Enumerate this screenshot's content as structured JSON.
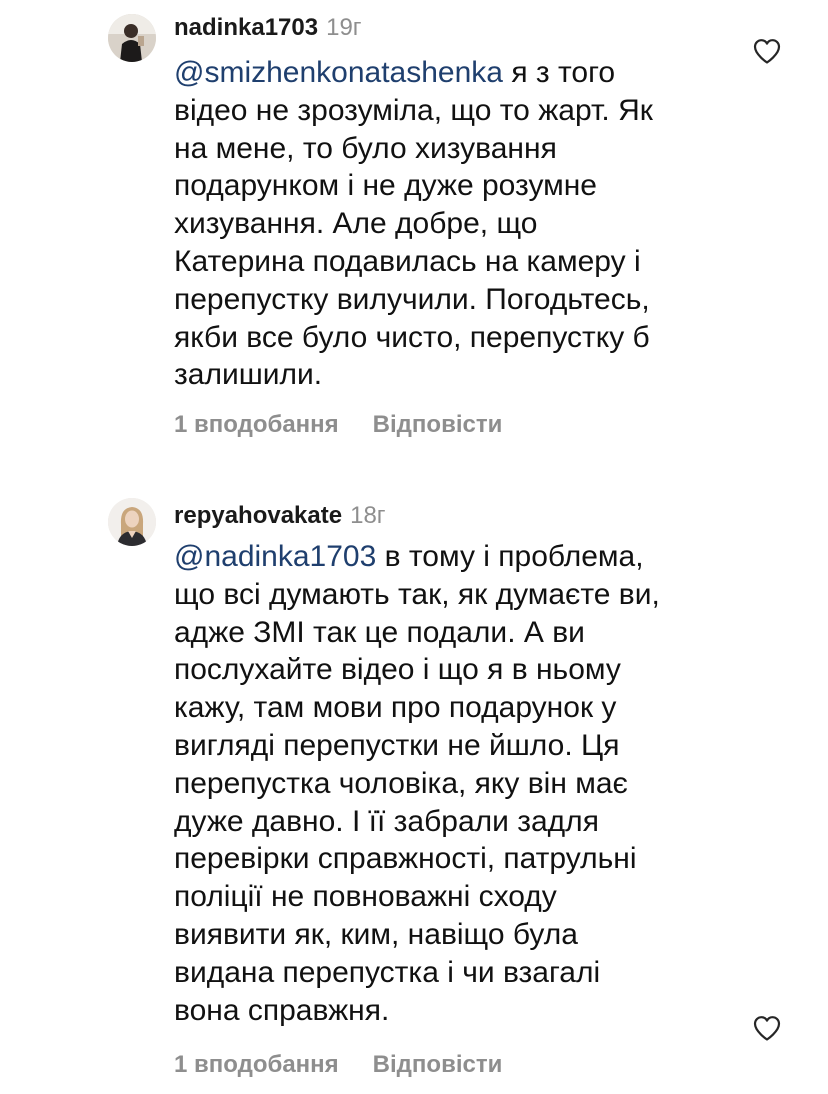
{
  "comments": [
    {
      "username": "nadinka1703",
      "time": "19г",
      "mention": "@smizhenkonatashenka",
      "lines": [
        " я з того",
        "відео не зрозуміла, що то жарт. Як",
        "на мене, то було хизування",
        "подарунком і не дуже розумне",
        "хизування. Але добре, що",
        "Катерина подавилась на камеру і",
        "перепустку вилучили. Погодьтесь,",
        "якби все було чисто, перепустку б",
        "залишили."
      ],
      "likes_label": "1 вподобання",
      "reply_label": "Відповісти"
    },
    {
      "username": "repyahovakate",
      "time": "18г",
      "mention": "@nadinka1703",
      "lines": [
        " в тому і проблема,",
        "що всі думають так, як думаєте ви,",
        "адже ЗМІ так це подали. А ви",
        "послухайте відео і що я в ньому",
        "кажу, там мови про подарунок у",
        "вигляді перепустки не йшло. Ця",
        "перепустка чоловіка, яку він має",
        "дуже давно. І її забрали задля",
        "перевірки справжності, патрульні",
        "поліції не повноважні сходу",
        "виявити як, ким, навіщо була",
        "видана перепустка і чи взагалі",
        "вона справжня."
      ],
      "likes_label": "1 вподобання",
      "reply_label": "Відповісти"
    }
  ],
  "icons": {
    "like": "heart-outline-icon",
    "avatar": "user-avatar"
  },
  "colors": {
    "text": "#111111",
    "muted": "#8e8e8e",
    "mention": "#1f3f6e",
    "background": "#ffffff"
  }
}
